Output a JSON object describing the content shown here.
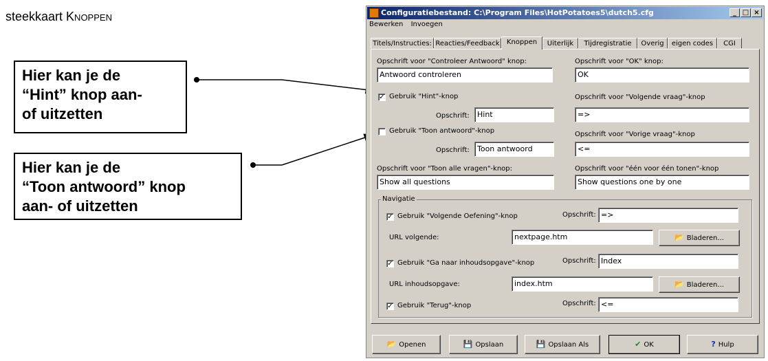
{
  "heading": {
    "prefix": "steekkaart ",
    "word": "Knoppen"
  },
  "callouts": [
    {
      "lines": [
        "Hier kan je de",
        "“Hint” knop aan-",
        "of uitzetten"
      ]
    },
    {
      "lines": [
        "Hier kan je de",
        "“Toon antwoord” knop",
        "aan- of uitzetten"
      ]
    }
  ],
  "window": {
    "title": "Configuratiebestand: C:\\Program Files\\HotPotatoes5\\dutch5.cfg",
    "controls": [
      "_",
      "□",
      "×"
    ]
  },
  "menu": [
    "Bewerken",
    "Invoegen"
  ],
  "tabs": [
    "Titels/Instructies:",
    "Reacties/Feedback",
    "Knoppen",
    "Uiterlijk",
    "Tijdregistratie",
    "Overig",
    "eigen codes",
    "CGI"
  ],
  "active_tab": "Knoppen",
  "form": {
    "check_label": "Opschrift voor \"Controleer Antwoord\" knop:",
    "check_value": "Antwoord controleren",
    "ok_label": "Opschrift voor \"OK\" knop:",
    "ok_value": "OK",
    "hint_check": "Gebruik \"Hint\"-knop",
    "hint_checked": "✓",
    "hint_caption_label": "Opschrift:",
    "hint_value": "Hint",
    "next_q_label": "Opschrift voor \"Volgende vraag\"-knop",
    "next_q_value": "=>",
    "show_answer_check": "Gebruik \"Toon antwoord\"-knop",
    "show_answer_checked": "",
    "show_answer_caption_label": "Opschrift:",
    "show_answer_value": "Toon antwoord",
    "prev_q_label": "Opschrift voor \"Vorige vraag\"-knop",
    "prev_q_value": "<=",
    "show_all_label": "Opschrift voor \"Toon alle vragen\"-knop:",
    "show_all_value": "Show all questions",
    "one_by_one_label": "Opschrift voor \"één voor één tonen\"-knop",
    "one_by_one_value": "Show questions one by one"
  },
  "nav": {
    "group_label": "Navigatie",
    "next_ex_check": "Gebruik \"Volgende Oefening\"-knop",
    "next_ex_checked": "✓",
    "next_ex_caption_label": "Opschrift:",
    "next_ex_caption": "=>",
    "url_next_label": "URL volgende:",
    "url_next": "nextpage.htm",
    "browse1": "Bladeren...",
    "contents_check": "Gebruik \"Ga naar inhoudsopgave\"-knop",
    "contents_checked": "✓",
    "contents_caption_label": "Opschrift:",
    "contents_caption": "Index",
    "url_contents_label": "URL inhoudsopgave:",
    "url_contents": "index.htm",
    "browse2": "Bladeren...",
    "back_check": "Gebruik \"Terug\"-knop",
    "back_checked": "✓",
    "back_caption_label": "Opschrift:",
    "back_caption": "<="
  },
  "buttons": {
    "open": "Openen",
    "save": "Opslaan",
    "save_as": "Opslaan Als",
    "ok": "OK",
    "help": "Hulp"
  }
}
